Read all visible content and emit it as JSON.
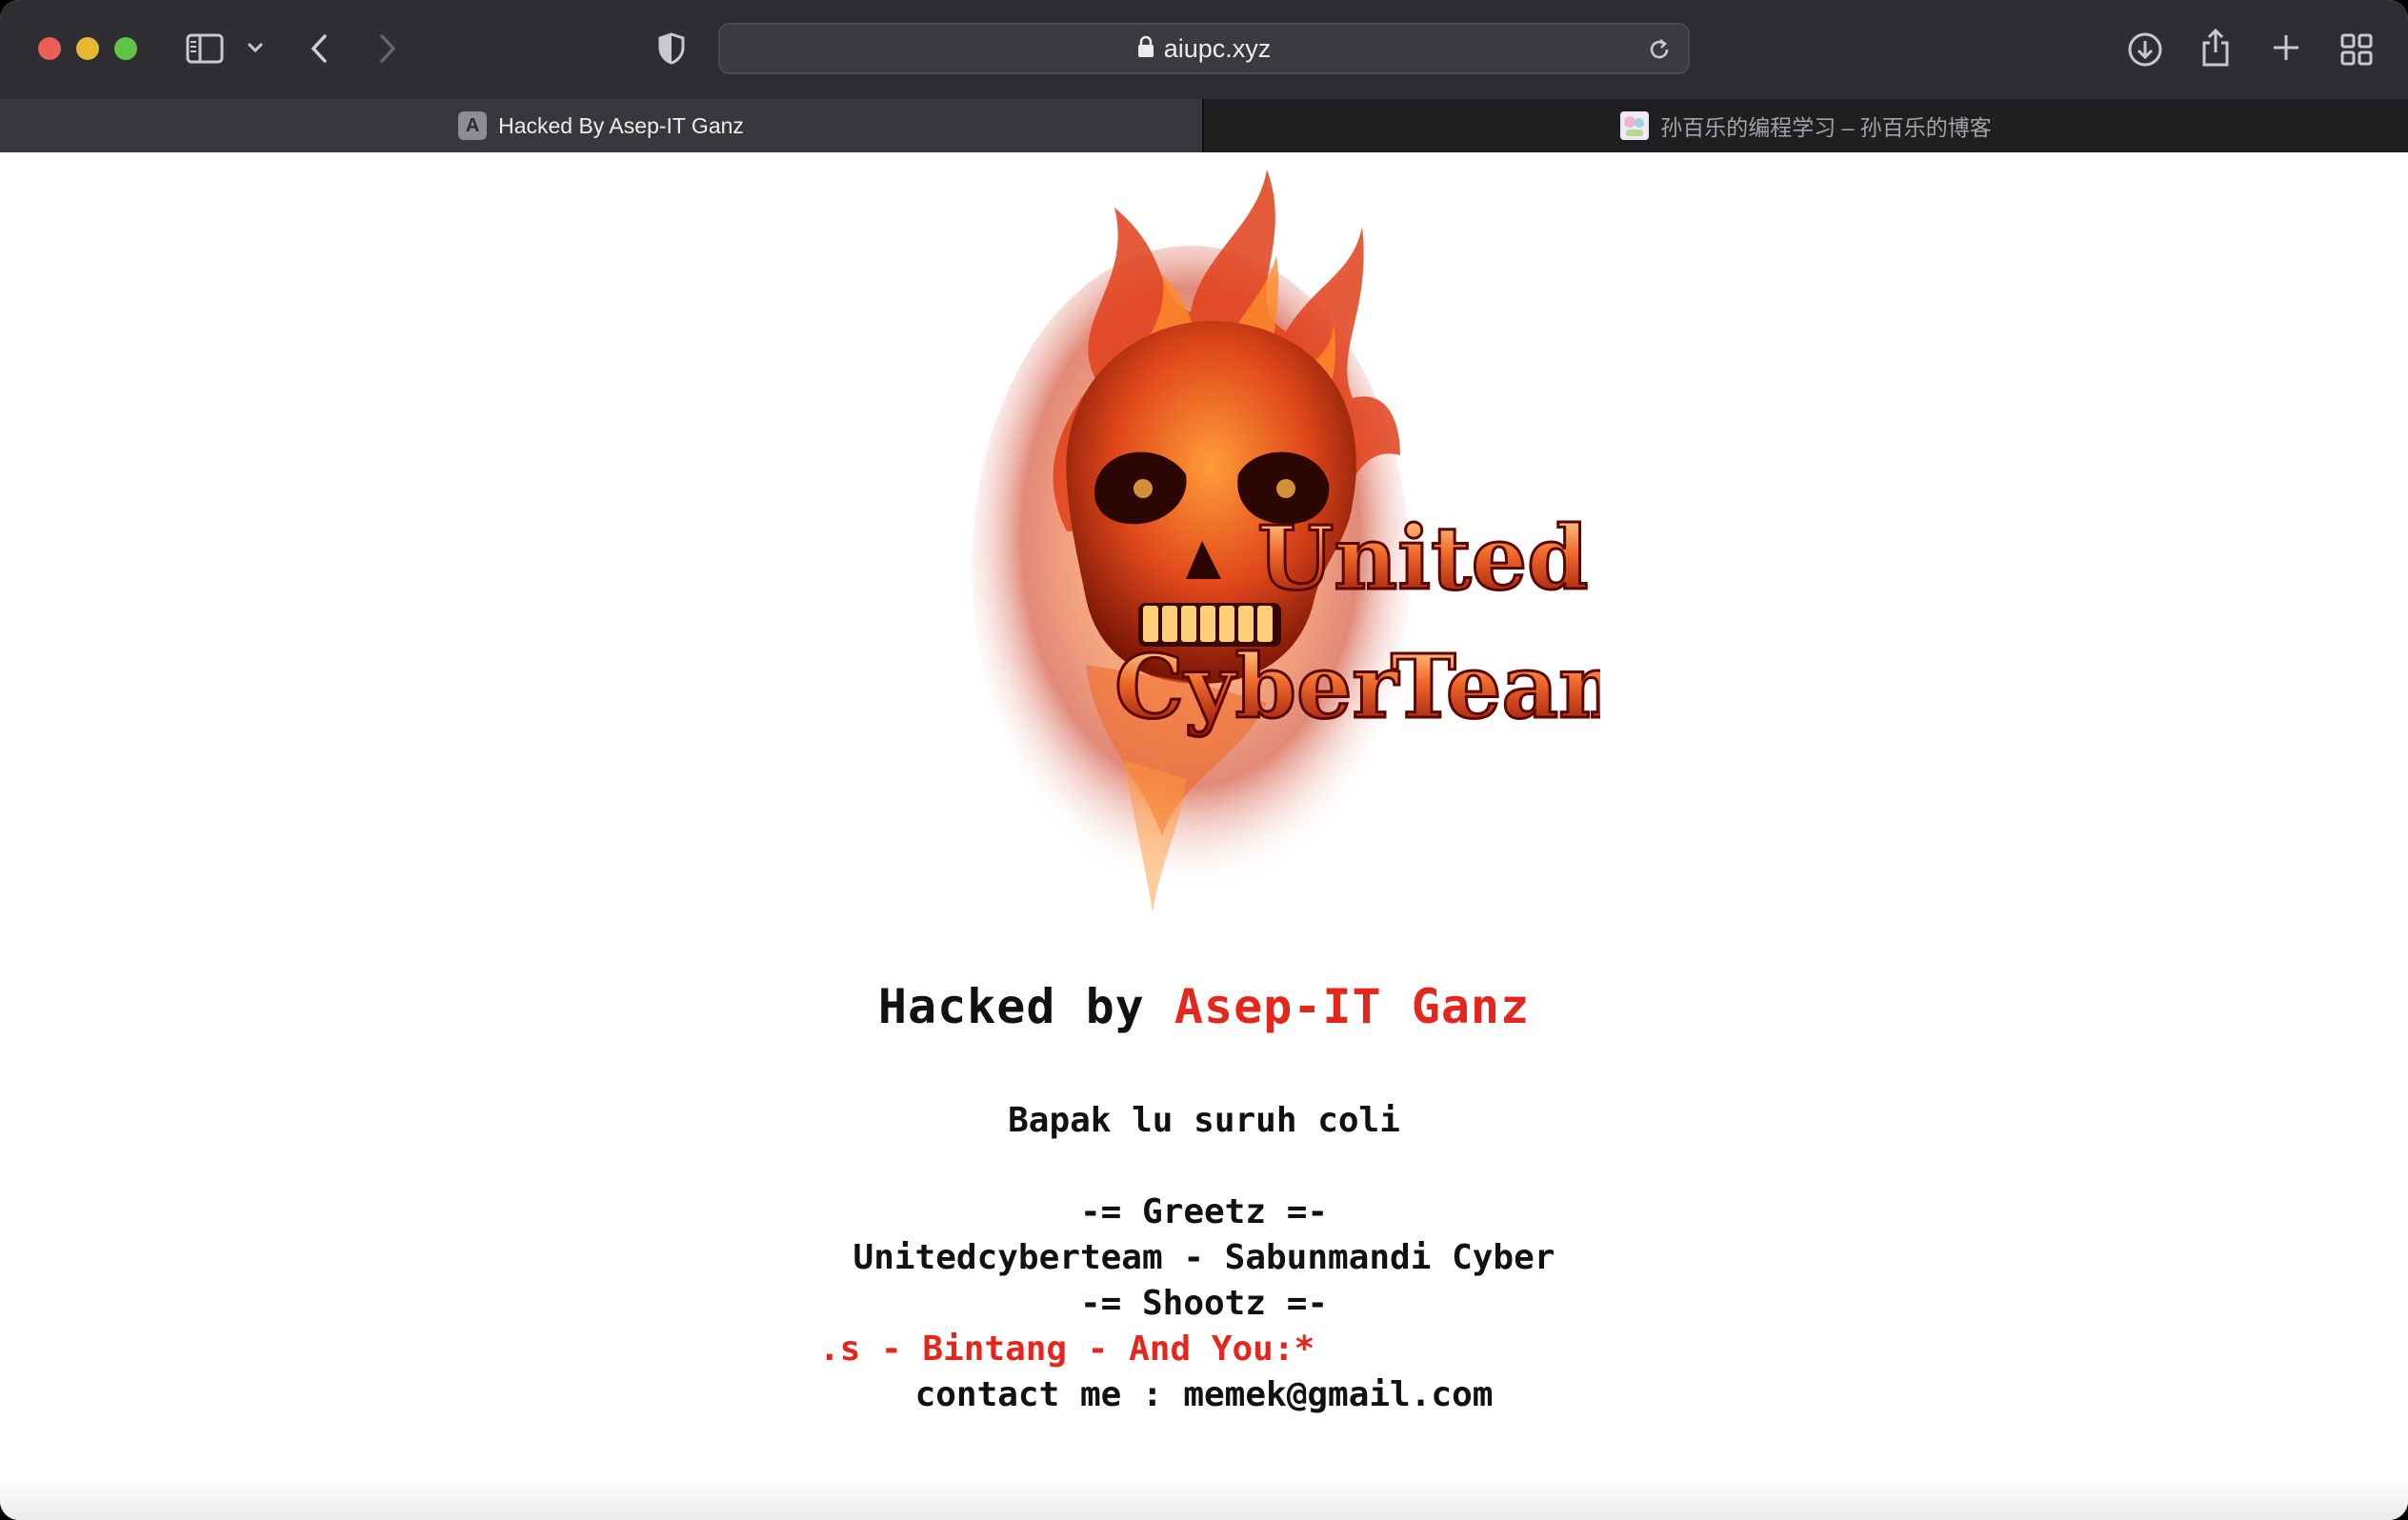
{
  "browser": {
    "url": "aiupc.xyz",
    "tabs": [
      {
        "title": "Hacked By Asep-IT Ganz",
        "favicon": "A",
        "active": true
      },
      {
        "title": "孙百乐的编程学习 – 孙百乐的博客",
        "active": false
      }
    ],
    "icons": {
      "sidebar": "sidebar-icon",
      "back": "chevron-left-icon",
      "forward": "chevron-right-icon",
      "privacy": "shield-icon",
      "lock": "lock-icon",
      "reload": "reload-icon",
      "download": "download-icon",
      "share": "share-icon",
      "new_tab": "plus-icon",
      "tab_overview": "grid-icon"
    }
  },
  "page": {
    "logo_text": {
      "line1": "United",
      "line2a": "Cyber",
      "line2b": "Team"
    },
    "heading_prefix": "Hacked by ",
    "heading_name": "Asep-IT Ganz",
    "message": "Bapak lu suruh coli",
    "greetz_header": "-= Greetz =-",
    "greetz_names": "Unitedcyberteam - Sabunmandi Cyber",
    "shootz_header": "-= Shootz =-",
    "shootz_names": ".s - Bintang - And You:*",
    "contact": "contact me : memek@gmail.com"
  },
  "colors": {
    "accent_red": "#e5261c",
    "toolbar": "#2e2d31",
    "tabbar": "#1f1e21"
  }
}
